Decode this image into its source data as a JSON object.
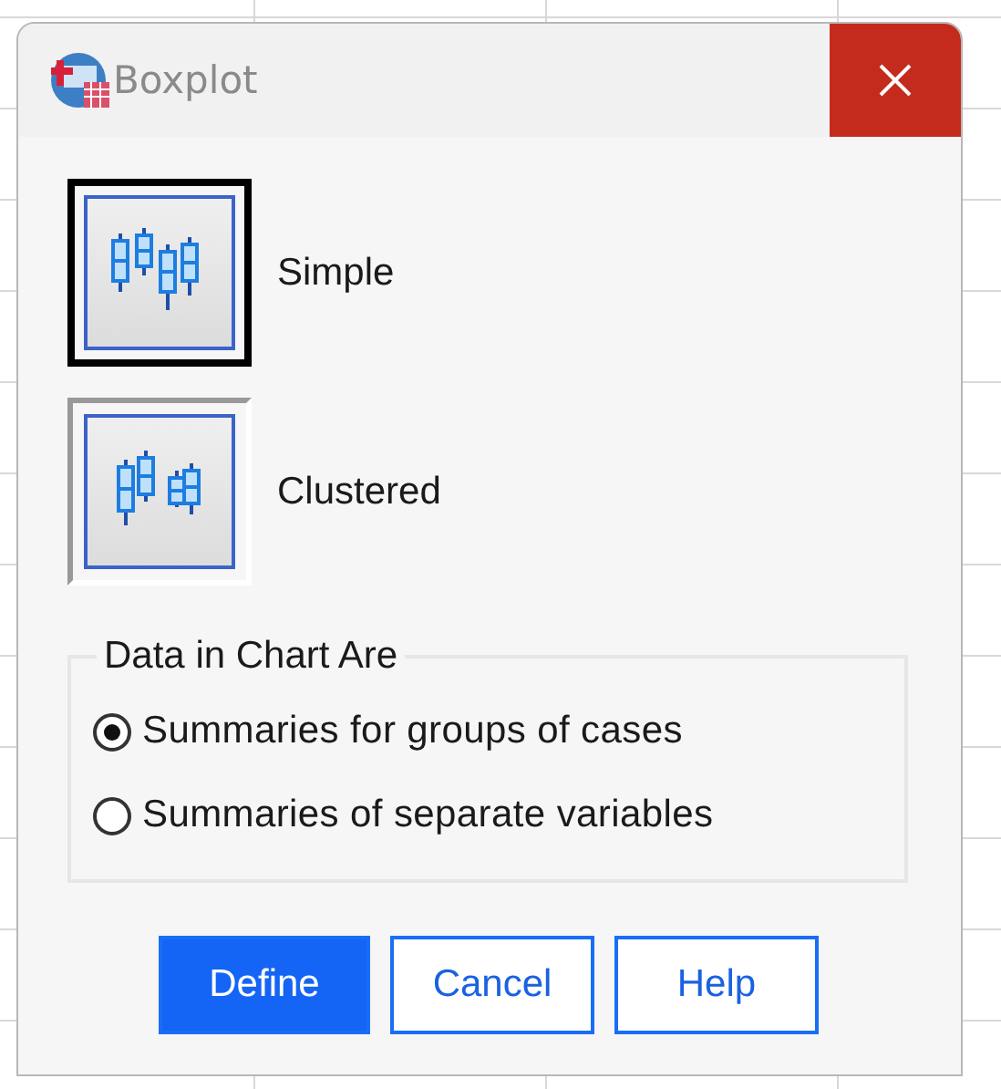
{
  "window": {
    "title": "Boxplot"
  },
  "chart_types": [
    {
      "kind": "simple",
      "label": "Simple",
      "selected": true
    },
    {
      "kind": "clustered",
      "label": "Clustered",
      "selected": false
    }
  ],
  "data_group": {
    "title": "Data in Chart Are",
    "options": [
      {
        "label": "Summaries for groups of cases",
        "selected": true
      },
      {
        "label": "Summaries of separate variables",
        "selected": false
      }
    ]
  },
  "buttons": [
    {
      "label": "Define",
      "kind": "primary"
    },
    {
      "label": "Cancel",
      "kind": "normal"
    },
    {
      "label": "Help",
      "kind": "normal"
    }
  ]
}
